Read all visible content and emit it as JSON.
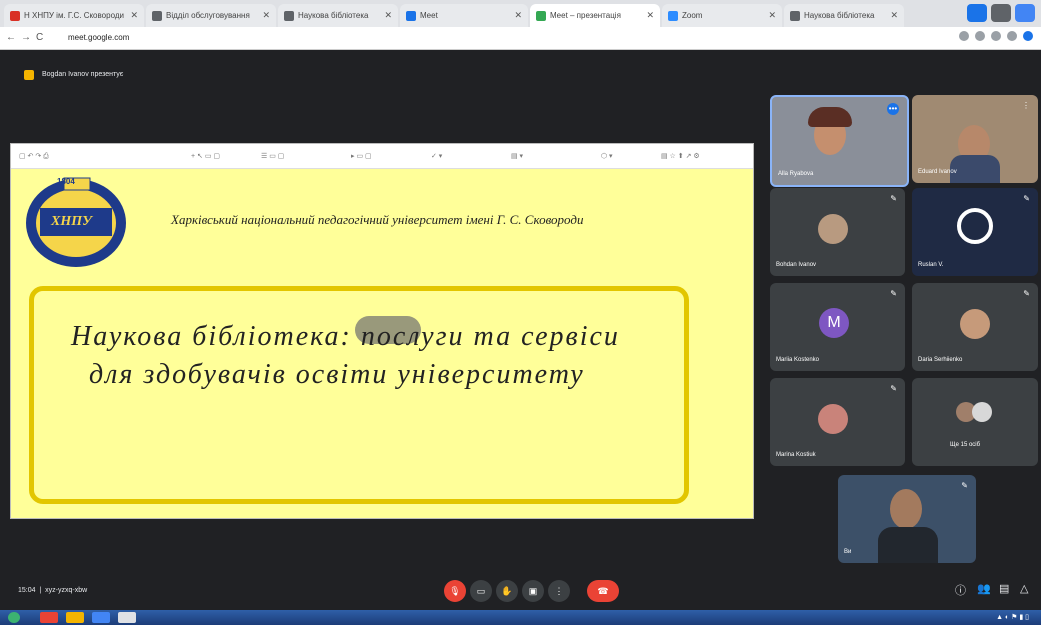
{
  "browser": {
    "tabs": [
      {
        "title": "Н ХНПУ ім. Г.С. Сковороди",
        "active": false
      },
      {
        "title": "Відділ обслуговування",
        "active": false
      },
      {
        "title": "Наукова бібліотека",
        "active": false
      },
      {
        "title": "Meet",
        "active": false
      },
      {
        "title": "Meet – презентація",
        "active": true
      },
      {
        "title": "Zoom",
        "active": false
      },
      {
        "title": "Наукова бібліотека",
        "active": false
      }
    ],
    "url": "meet.google.com"
  },
  "meet": {
    "header_title": "Bogdan Ivanov презентує"
  },
  "slide": {
    "university": "Харківський національний педагогічний університет імені Г. С. Сковороди",
    "emblem_year": "1804",
    "emblem_text": "ХНПУ",
    "title_line1": "Наукова бібліотека: послуги та сервіси",
    "title_line2": "для здобувачів освіти університету"
  },
  "participants": [
    {
      "name": "Alla Ryabova"
    },
    {
      "name": "Eduard Ivanov"
    },
    {
      "name": "Bohdan Ivanov"
    },
    {
      "name": "Ruslan V."
    },
    {
      "name": "Mariia Kostenko",
      "initial": "M"
    },
    {
      "name": "Daria Serhiienko"
    },
    {
      "name": "Marina Kostiuk"
    },
    {
      "name": "Ще 15 осіб"
    },
    {
      "name": "Ви"
    }
  ],
  "bottom": {
    "time": "15:04",
    "meeting_code": "xyz-yzxq-xbw"
  },
  "colors": {
    "slide_bg": "#ffff99",
    "frame": "#e2c600",
    "meet_bg": "#202124",
    "end_call": "#ea4335",
    "avatar_m": "#7e57c2"
  }
}
